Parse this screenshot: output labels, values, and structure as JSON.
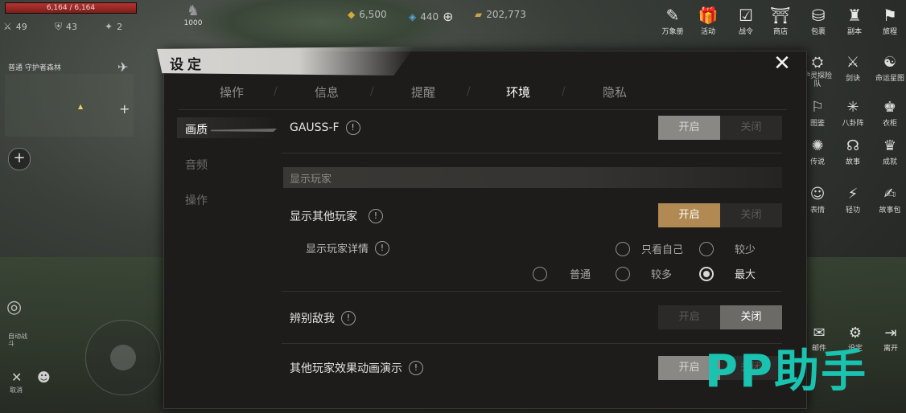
{
  "hud": {
    "hp_text": "6,164 / 6,164",
    "hp_fraction": 1.0,
    "stats": [
      {
        "icon": "sword-icon",
        "glyph": "⚔",
        "value": "49"
      },
      {
        "icon": "shield-icon",
        "glyph": "⛨",
        "value": "43"
      },
      {
        "icon": "star-icon",
        "glyph": "✦",
        "value": "2"
      }
    ],
    "level_value": "1000",
    "currencies": [
      {
        "icon": "gold-coin-icon",
        "glyph": "◆",
        "value": "6,500"
      },
      {
        "icon": "gem-icon",
        "glyph": "◈",
        "value": "440"
      },
      {
        "icon": "ingot-icon",
        "glyph": "▰",
        "value": "202,773"
      }
    ],
    "top_menu": [
      {
        "icon": "scroll-icon",
        "glyph": "✎",
        "label": "万象册"
      },
      {
        "icon": "gift-icon",
        "glyph": "🎁",
        "label": "活动"
      },
      {
        "icon": "checklist-icon",
        "glyph": "☑",
        "label": "战令"
      },
      {
        "icon": "shop-icon",
        "glyph": "⛩",
        "label": "商店"
      },
      {
        "icon": "bag-icon",
        "glyph": "⛁",
        "label": "包裹"
      },
      {
        "icon": "helmet-icon",
        "glyph": "♜",
        "label": "副本"
      },
      {
        "icon": "flag-icon",
        "glyph": "⚑",
        "label": "旅程"
      }
    ],
    "side_menu": [
      {
        "icon": "recruit-icon",
        "glyph": "⛭",
        "label": "护灵探险队"
      },
      {
        "icon": "blade-icon",
        "glyph": "⚔",
        "label": "剑诀"
      },
      {
        "icon": "fate-icon",
        "glyph": "☯",
        "label": "命运星图"
      },
      {
        "icon": "chart-icon",
        "glyph": "⚐",
        "label": "图鉴"
      },
      {
        "icon": "bagua-icon",
        "glyph": "✳",
        "label": "八卦阵"
      },
      {
        "icon": "robe-icon",
        "glyph": "♚",
        "label": "衣柜"
      },
      {
        "icon": "legend-icon",
        "glyph": "✺",
        "label": "传说"
      },
      {
        "icon": "story-icon",
        "glyph": "☊",
        "label": "故事"
      },
      {
        "icon": "achievement-icon",
        "glyph": "♛",
        "label": "成就"
      },
      {
        "icon": "emote-icon",
        "glyph": "☺",
        "label": "表情"
      },
      {
        "icon": "lightness-icon",
        "glyph": "⚡",
        "label": "轻功"
      },
      {
        "icon": "storybook-icon",
        "glyph": "✍",
        "label": "故事包"
      }
    ],
    "bottom_menu": [
      {
        "icon": "mail-icon",
        "glyph": "✉",
        "label": "邮件"
      },
      {
        "icon": "settings-icon",
        "glyph": "⚙",
        "label": "设定"
      },
      {
        "icon": "exit-icon",
        "glyph": "⇥",
        "label": "离开"
      }
    ],
    "map_title": "普通  守护者森林",
    "radar_label": "自动战斗",
    "bottom_left": [
      {
        "icon": "cancel-icon",
        "glyph": "✕",
        "label": "取消"
      },
      {
        "icon": "team-icon",
        "glyph": "☻",
        "label": ""
      }
    ]
  },
  "dialog": {
    "title": "设定",
    "tabs": [
      "操作",
      "信息",
      "提醒",
      "环境",
      "隐私"
    ],
    "active_tab": 3,
    "side_nav": [
      "画质",
      "音频",
      "操作"
    ],
    "active_nav": 0,
    "rows": {
      "gauss": {
        "label": "GAUSS-F",
        "on": "开启",
        "off": "关闭"
      },
      "section": "显示玩家",
      "show_players": {
        "label": "显示其他玩家",
        "on": "开启",
        "off": "关闭"
      },
      "player_detail": {
        "label": "显示玩家详情",
        "options": [
          "只看自己",
          "较少",
          "普通",
          "较多",
          "最大"
        ],
        "selected": "最大"
      },
      "friend_foe": {
        "label": "辨别敌我",
        "on": "开启",
        "off": "关闭"
      },
      "effects": {
        "label": "其他玩家效果动画演示",
        "on": "开启",
        "off": "关闭"
      }
    }
  },
  "watermark": "PP助手",
  "colors": {
    "gold_toggle": "#b08a52",
    "grey_toggle": "#6b6a67",
    "watermark": "#19c3b0"
  }
}
